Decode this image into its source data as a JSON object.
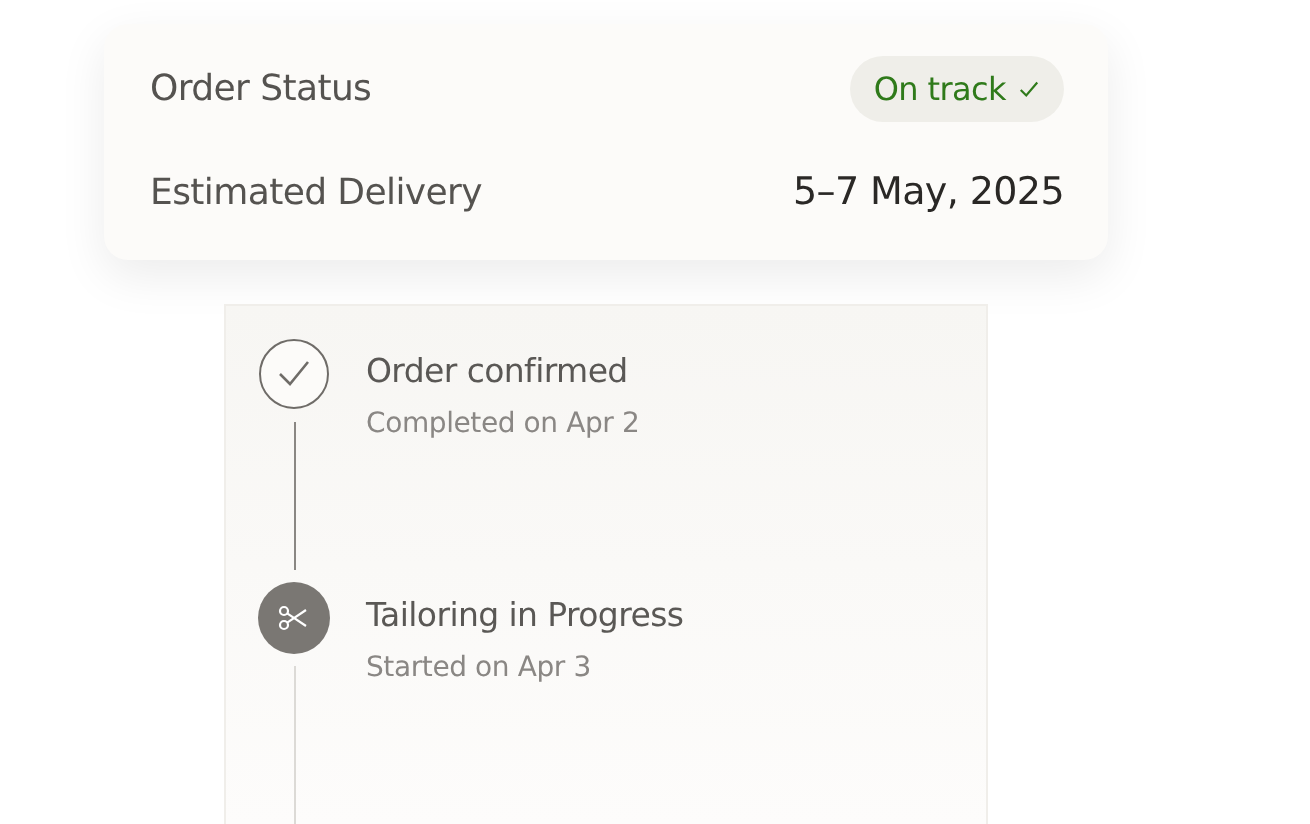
{
  "summary": {
    "rows": [
      {
        "label": "Order Status",
        "kind": "badge",
        "value": "On track"
      },
      {
        "label": "Estimated Delivery",
        "kind": "text",
        "value": "5–7 May, 2025"
      }
    ]
  },
  "timeline": {
    "steps": [
      {
        "kind": "done",
        "title": "Order confirmed",
        "detail": "Completed on Apr 2"
      },
      {
        "kind": "active",
        "title": "Tailoring in Progress",
        "detail": "Started on Apr 3"
      }
    ]
  }
}
